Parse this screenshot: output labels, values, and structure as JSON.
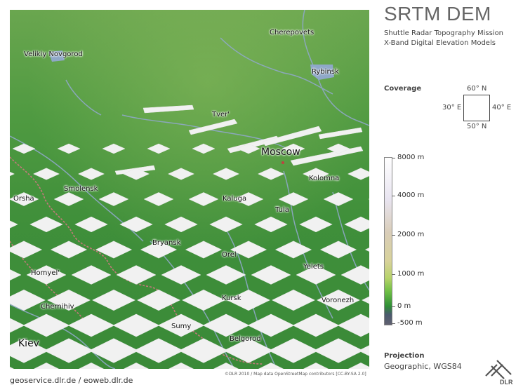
{
  "header": {
    "title": "SRTM DEM",
    "subtitle_line1": "Shuttle Radar Topography Mission",
    "subtitle_line2": "X-Band Digital Elevation Models"
  },
  "coverage": {
    "label": "Coverage",
    "north": "60° N",
    "south": "50° N",
    "west": "30° E",
    "east": "40° E"
  },
  "elevation_scale": {
    "ticks": [
      "8000 m",
      "4000 m",
      "2000 m",
      "1000 m",
      "0 m",
      "-500 m"
    ]
  },
  "projection": {
    "label": "Projection",
    "value": "Geographic, WGS84"
  },
  "logo": {
    "text": "DLR"
  },
  "map": {
    "attribution": "©DLR 2010 / Map data OpenStreetMap contributors [CC-BY-SA 2.0]",
    "cities": [
      {
        "name": "Cherepovets"
      },
      {
        "name": "Velikiy Novgorod"
      },
      {
        "name": "Rybinsk"
      },
      {
        "name": "Tver'"
      },
      {
        "name": "Moscow"
      },
      {
        "name": "Kolomna"
      },
      {
        "name": "Smolensk"
      },
      {
        "name": "Orsha"
      },
      {
        "name": "Kaluga"
      },
      {
        "name": "Tula"
      },
      {
        "name": "Bryansk"
      },
      {
        "name": "Orel"
      },
      {
        "name": "Homyel'"
      },
      {
        "name": "Yelets"
      },
      {
        "name": "Chernihiv"
      },
      {
        "name": "Kursk"
      },
      {
        "name": "Voronezh"
      },
      {
        "name": "Sumy"
      },
      {
        "name": "Kiev"
      },
      {
        "name": "Belgorod"
      }
    ]
  },
  "footer": {
    "links": "geoservice.dlr.de / eoweb.dlr.de"
  },
  "colors": {
    "terrain_green": "#3f8f3a",
    "water": "#8fa8c8",
    "gap": "#f2f2f2",
    "border": "#c47a7a"
  }
}
